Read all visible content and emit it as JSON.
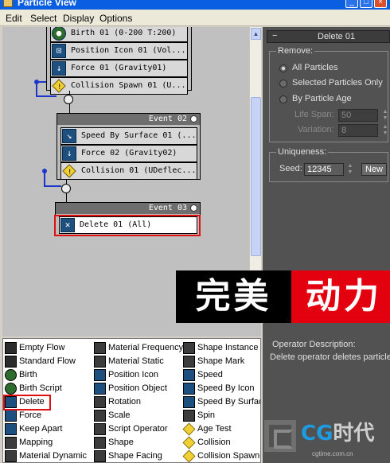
{
  "window": {
    "title": "Particle View"
  },
  "menu": [
    "Edit",
    "Select",
    "Display",
    "Options"
  ],
  "events": [
    {
      "title": "",
      "operators": [
        {
          "label": "Birth 01 (0-200 T:200)",
          "icon": "birth-icon"
        },
        {
          "label": "Position Icon 01 (Vol...",
          "icon": "position-icon"
        },
        {
          "label": "Force 01 (Gravity01)",
          "icon": "force-icon"
        },
        {
          "label": "Collision Spawn 01 (U...",
          "icon": "collision-spawn-icon"
        }
      ]
    },
    {
      "title": "Event 02",
      "operators": [
        {
          "label": "Speed By Surface 01 (...",
          "icon": "speed-by-surface-icon"
        },
        {
          "label": "Force 02 (Gravity02)",
          "icon": "force-icon"
        },
        {
          "label": "Collision 01 (UDeflec...",
          "icon": "collision-icon"
        }
      ]
    },
    {
      "title": "Event 03",
      "operators": [
        {
          "label": "Delete 01 (All)",
          "icon": "delete-icon"
        }
      ]
    }
  ],
  "rollout": {
    "title": "Delete 01",
    "remove_label": "Remove:",
    "options": [
      "All Particles",
      "Selected Particles Only",
      "By Particle Age"
    ],
    "selected": "All Particles",
    "life_span_label": "Life Span:",
    "life_span": "50",
    "variation_label": "Variation:",
    "variation": "8",
    "uniqueness_label": "Uniqueness:",
    "seed_label": "Seed:",
    "seed": "12345",
    "new_label": "New"
  },
  "banner": {
    "left": "完美",
    "right": "动力"
  },
  "depot": {
    "columns": [
      [
        "Empty Flow",
        "Standard Flow",
        "Birth",
        "Birth Script",
        "Delete",
        "Force",
        "Keep Apart",
        "Mapping",
        "Material Dynamic"
      ],
      [
        "Material Frequency",
        "Material Static",
        "Position Icon",
        "Position Object",
        "Rotation",
        "Scale",
        "Script Operator",
        "Shape",
        "Shape Facing"
      ],
      [
        "Shape Instance",
        "Shape Mark",
        "Speed",
        "Speed By Icon",
        "Speed By Surfac",
        "Spin",
        "Age Test",
        "Collision",
        "Collision Spawn"
      ]
    ],
    "highlighted": "Delete"
  },
  "description": {
    "title": "Operator Description:",
    "text": "Delete operator deletes particles"
  },
  "logo": {
    "cg": "CG",
    "cn": "时代",
    "url": "cgtime.com.cn"
  },
  "colors": {
    "highlight": "#e01010",
    "wire_blue": "#1c36c8",
    "banner_red": "#e3000f"
  }
}
